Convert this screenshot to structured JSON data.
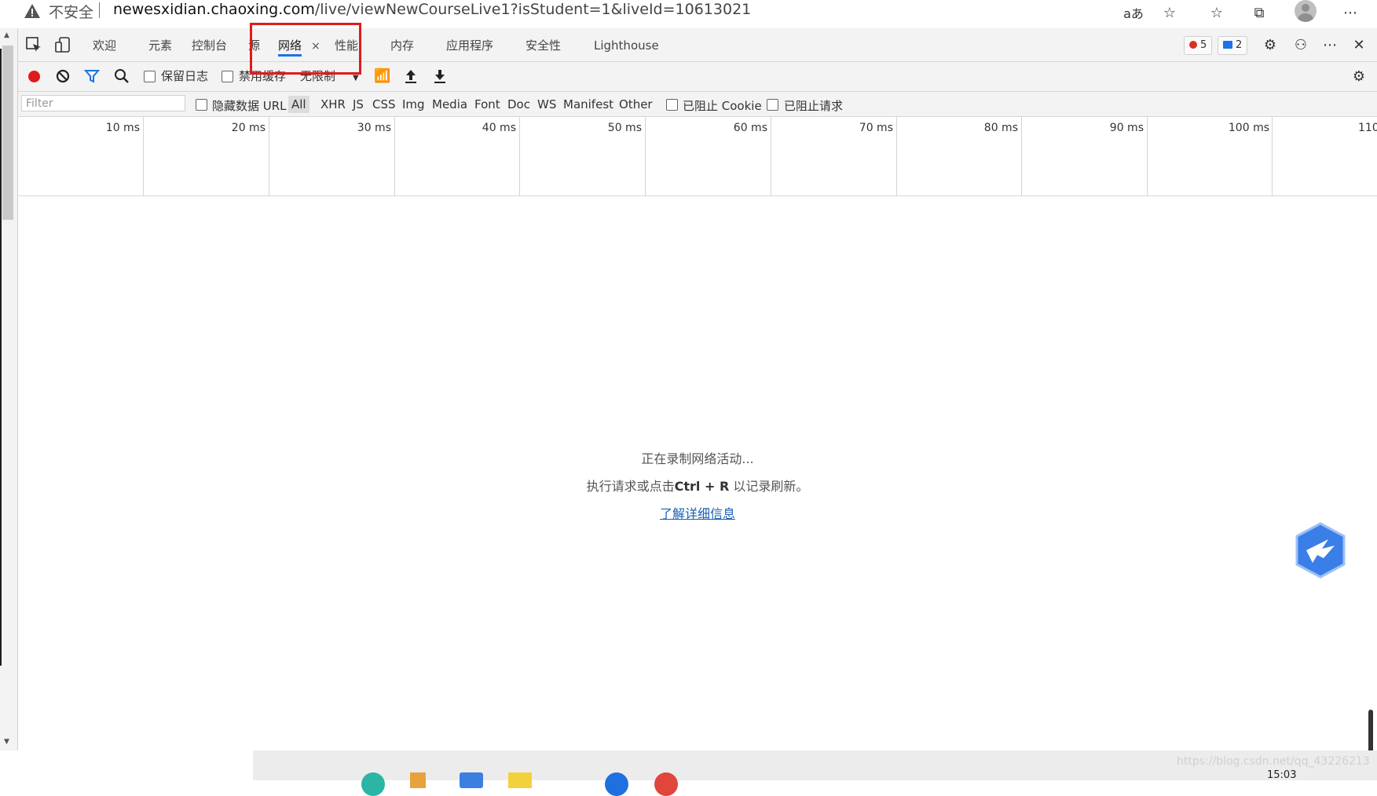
{
  "address_bar": {
    "insecure_label": "不安全",
    "url_host": "newesxidian.chaoxing.com",
    "url_path": "/live/viewNewCourseLive1?isStudent=1&liveId=10613021",
    "translate_icon_text": "aあ"
  },
  "devtools": {
    "tabs": [
      {
        "label": "欢迎"
      },
      {
        "label": "元素"
      },
      {
        "label": "控制台"
      },
      {
        "label": "源"
      },
      {
        "label": "网络",
        "active": true
      },
      {
        "label": "性能"
      },
      {
        "label": "内存"
      },
      {
        "label": "应用程序"
      },
      {
        "label": "安全性"
      },
      {
        "label": "Lighthouse"
      }
    ],
    "error_count": "5",
    "message_count": "2",
    "close_tab_glyph": "×"
  },
  "toolbar": {
    "preserve_log_label": "保留日志",
    "disable_cache_label": "禁用缓存",
    "throttling_value": "无限制"
  },
  "filter_bar": {
    "filter_placeholder": "Filter",
    "hide_data_url_label": "隐藏数据 URL",
    "types": [
      "All",
      "XHR",
      "JS",
      "CSS",
      "Img",
      "Media",
      "Font",
      "Doc",
      "WS",
      "Manifest",
      "Other"
    ],
    "selected_type": "All",
    "blocked_cookies_label": "已阻止 Cookie",
    "blocked_requests_label": "已阻止请求"
  },
  "overview": {
    "ticks": [
      "10 ms",
      "20 ms",
      "30 ms",
      "40 ms",
      "50 ms",
      "60 ms",
      "70 ms",
      "80 ms",
      "90 ms",
      "100 ms",
      "110"
    ]
  },
  "empty_state": {
    "line1": "正在录制网络活动...",
    "line2_prefix": "执行请求或点击",
    "line2_key": "Ctrl + R",
    "line2_suffix": "以记录刷新。",
    "learn_more": "了解详细信息"
  },
  "watermark": "https://blog.csdn.net/qq_43226213",
  "taskbar_time": "15:03",
  "colors": {
    "accent": "#1a73e8",
    "record_red": "#e01b1b",
    "highlight_box": "#e01b1b"
  }
}
